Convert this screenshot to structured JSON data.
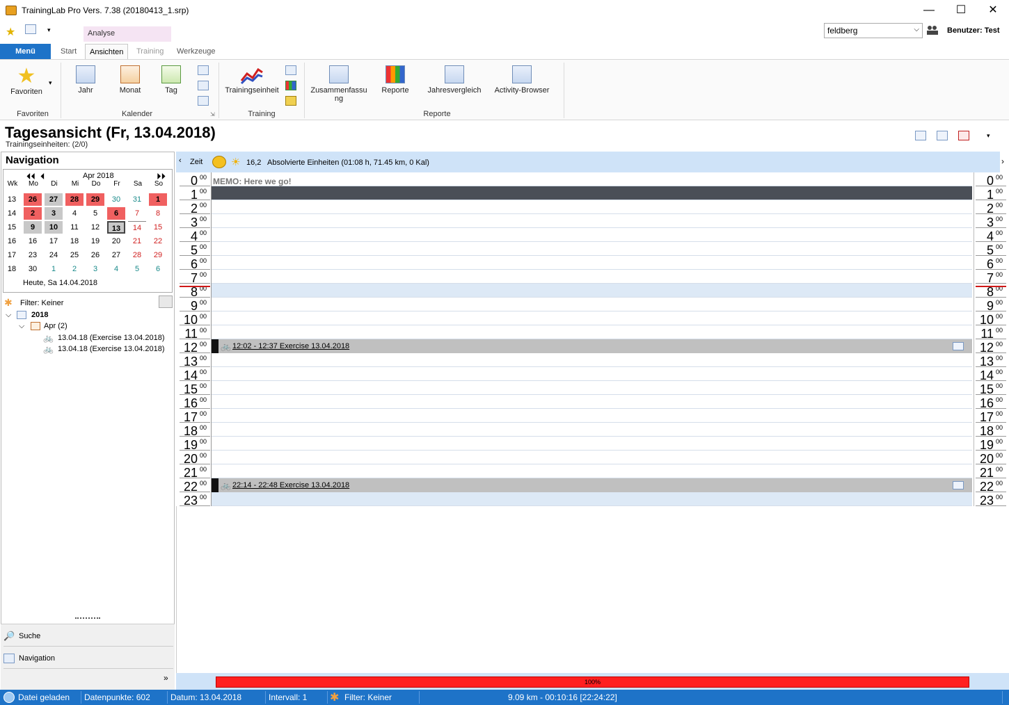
{
  "window": {
    "title": "TrainingLab Pro Vers. 7.38 (20180413_1.srp)",
    "minimize": "—",
    "maximize": "☐",
    "close": "✕"
  },
  "qat": {
    "star": "★",
    "more": "▾"
  },
  "context_tab_header": "Analyse",
  "user": {
    "select_value": "feldberg",
    "label": "Benutzer: Test"
  },
  "ribbon": {
    "menu": "Menü",
    "tabs": [
      "Start",
      "Ansichten",
      "Training",
      "Werkzeuge"
    ],
    "groups": {
      "favoriten": "Favoriten",
      "kalender": "Kalender",
      "training": "Training",
      "reporte": "Reporte"
    },
    "buttons": {
      "favoriten": "Favoriten",
      "jahr": "Jahr",
      "monat": "Monat",
      "tag": "Tag",
      "trainingseinheit": "Trainingseinheit",
      "zusammenfassung_1": "Zusammenfassu",
      "zusammenfassung_2": "ng",
      "reporte": "Reporte",
      "jahresvergleich": "Jahresvergleich",
      "activity_browser": "Activity-Browser"
    }
  },
  "page": {
    "title": "Tagesansicht (Fr, 13.04.2018)",
    "subtitle": "Trainingseinheiten: (2/0)"
  },
  "navigation": {
    "title": "Navigation",
    "month": "Apr 2018",
    "weekday_headers": [
      "Wk",
      "Mo",
      "Di",
      "Mi",
      "Do",
      "Fr",
      "Sa",
      "So"
    ],
    "weeks": [
      {
        "wk": "13",
        "days": [
          "26",
          "27",
          "28",
          "29",
          "30",
          "31",
          "1"
        ]
      },
      {
        "wk": "14",
        "days": [
          "2",
          "3",
          "4",
          "5",
          "6",
          "7",
          "8"
        ]
      },
      {
        "wk": "15",
        "days": [
          "9",
          "10",
          "11",
          "12",
          "13",
          "14",
          "15"
        ]
      },
      {
        "wk": "16",
        "days": [
          "16",
          "17",
          "18",
          "19",
          "20",
          "21",
          "22"
        ]
      },
      {
        "wk": "17",
        "days": [
          "23",
          "24",
          "25",
          "26",
          "27",
          "28",
          "29"
        ]
      },
      {
        "wk": "18",
        "days": [
          "30",
          "1",
          "2",
          "3",
          "4",
          "5",
          "6"
        ]
      }
    ],
    "today": "Heute, Sa 14.04.2018",
    "filter": "Filter: Keiner",
    "tree": {
      "year": "2018",
      "month": "Apr (2)",
      "items": [
        "13.04.18 (Exercise 13.04.2018)",
        "13.04.18 (Exercise 13.04.2018)"
      ]
    },
    "bottom": {
      "search": "Suche",
      "navigation": "Navigation"
    }
  },
  "day_view": {
    "zeit": "Zeit",
    "temperature": "16,2",
    "summary": "Absolvierte Einheiten (01:08 h, 71.45 km, 0 Kal)",
    "memo": "MEMO: Here we go!",
    "minutes_suffix": "00",
    "hours": [
      "0",
      "1",
      "2",
      "3",
      "4",
      "5",
      "6",
      "7",
      "8",
      "9",
      "10",
      "11",
      "12",
      "13",
      "14",
      "15",
      "16",
      "17",
      "18",
      "19",
      "20",
      "21",
      "22",
      "23"
    ],
    "events": [
      {
        "hour": 12,
        "text": "12:02 - 12:37 Exercise 13.04.2018"
      },
      {
        "hour": 22,
        "text": "22:14 - 22:48 Exercise 13.04.2018"
      }
    ],
    "progress_label": "100%"
  },
  "status": {
    "loaded": "Datei geladen",
    "points": "Datenpunkte: 602",
    "date": "Datum: 13.04.2018",
    "interval": "Intervall: 1",
    "filter": "Filter: Keiner",
    "summary": "9.09 km - 00:10:16 [22:24:22]"
  }
}
